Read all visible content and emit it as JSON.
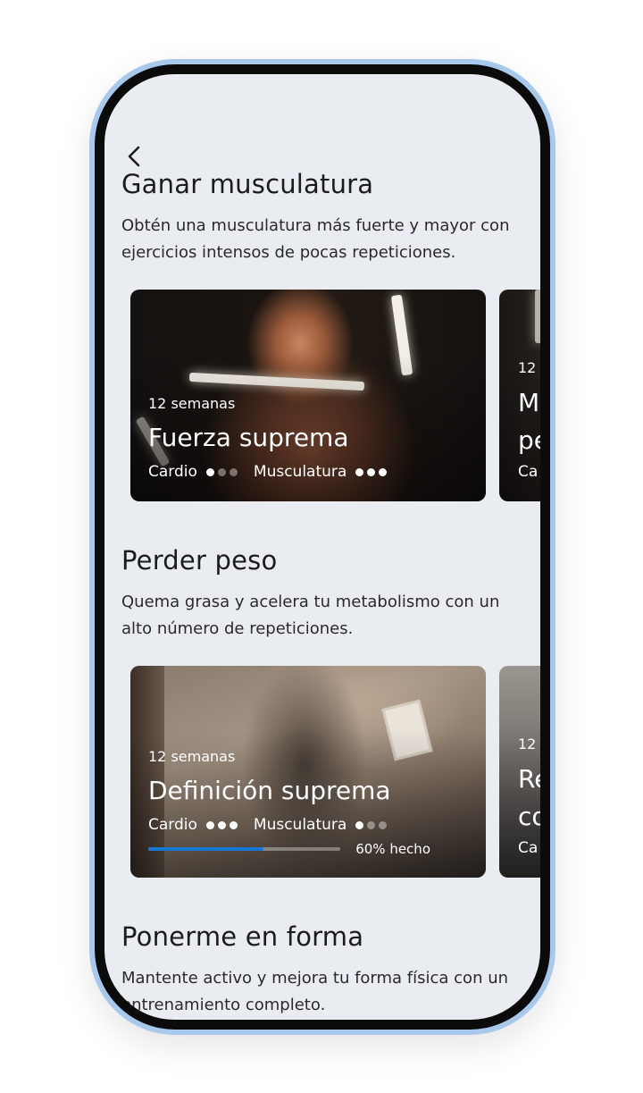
{
  "sections": [
    {
      "title": "Ganar musculatura",
      "description": "Obtén una musculatura más fuerte y mayor con ejercicios intensos de pocas repeticiones.",
      "cards": [
        {
          "duration": "12 semanas",
          "title": "Fuerza suprema",
          "cardio_label": "Cardio",
          "cardio_level": 1,
          "muscle_label": "Musculatura",
          "muscle_level": 3
        }
      ],
      "peek_card": {
        "duration": "12",
        "title_line1": "M",
        "title_line2": "pe",
        "meta": "Ca"
      }
    },
    {
      "title": "Perder peso",
      "description": "Quema grasa y acelera tu metabolismo con un alto número de repeticiones.",
      "cards": [
        {
          "duration": "12 semanas",
          "title": "Definición suprema",
          "cardio_label": "Cardio",
          "cardio_level": 3,
          "muscle_label": "Musculatura",
          "muscle_level": 1,
          "progress": 0.6,
          "progress_label": "60% hecho"
        }
      ],
      "peek_card": {
        "duration": "12",
        "title_line1": "Re",
        "title_line2": "co",
        "meta": "Ca"
      }
    },
    {
      "title": "Ponerme en forma",
      "description": "Mantente activo y mejora tu forma física con un entrenamiento completo."
    }
  ],
  "icons": {
    "back": "chevron-left-icon"
  },
  "colors": {
    "screen_bg": "#e9edf1",
    "progress_accent": "#1877d4",
    "frame": "#a9c9ec"
  }
}
